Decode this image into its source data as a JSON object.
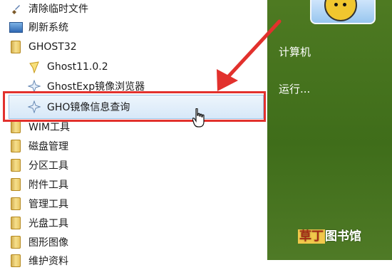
{
  "menu": {
    "items": [
      {
        "label": "清除临时文件",
        "icon": "brush-icon"
      },
      {
        "label": "刷新系统",
        "icon": "refresh-icon"
      },
      {
        "label": "GHOST32",
        "icon": "folder-icon"
      },
      {
        "label": "Ghost11.0.2",
        "icon": "ghost-icon"
      },
      {
        "label": "GhostExp镜像浏览器",
        "icon": "ghostexp-icon"
      },
      {
        "label": "GHO镜像信息查询",
        "icon": "gho-info-icon"
      },
      {
        "label": "WIM工具",
        "icon": "folder-icon"
      },
      {
        "label": "磁盘管理",
        "icon": "folder-icon"
      },
      {
        "label": "分区工具",
        "icon": "folder-icon"
      },
      {
        "label": "附件工具",
        "icon": "folder-icon"
      },
      {
        "label": "管理工具",
        "icon": "folder-icon"
      },
      {
        "label": "光盘工具",
        "icon": "folder-icon"
      },
      {
        "label": "图形图像",
        "icon": "folder-icon"
      },
      {
        "label": "维护资料",
        "icon": "folder-icon"
      }
    ]
  },
  "right_panel": {
    "items": [
      {
        "label": "计算机"
      },
      {
        "label": "运行..."
      }
    ]
  },
  "watermark": {
    "brand": "草丁",
    "rest": "图书馆"
  },
  "colors": {
    "highlight_border": "#e2312d",
    "selection": "#d7e8f8",
    "panel_green": "#3f6d1a"
  }
}
